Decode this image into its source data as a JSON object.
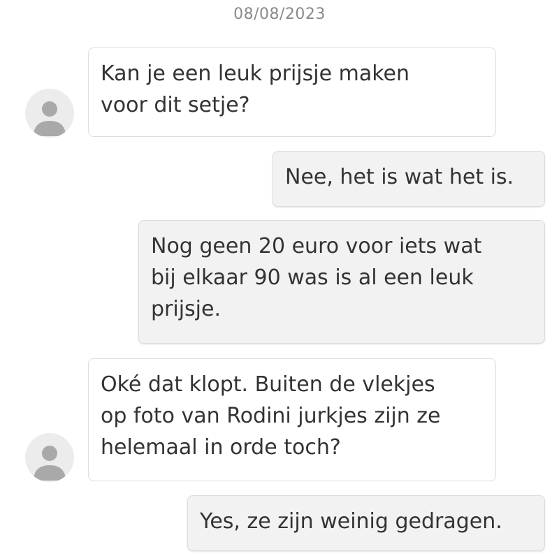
{
  "conversation": {
    "date": "08/08/2023",
    "messages": [
      {
        "direction": "incoming",
        "lines": [
          "Kan je een leuk prijsje maken",
          "voor dit setje?"
        ]
      },
      {
        "direction": "outgoing",
        "lines": [
          "Nee, het is wat het is."
        ]
      },
      {
        "direction": "outgoing",
        "lines": [
          "Nog geen 20 euro voor iets wat",
          "bij elkaar 90 was is al een leuk",
          "prijsje."
        ]
      },
      {
        "direction": "incoming",
        "lines": [
          "Oké dat klopt. Buiten de vlekjes",
          "op foto van Rodini jurkjes zijn ze",
          "helemaal in orde toch?"
        ]
      },
      {
        "direction": "outgoing",
        "lines": [
          "Yes, ze zijn weinig gedragen."
        ]
      }
    ]
  },
  "colors": {
    "avatar_bg": "#ececec",
    "avatar_glyph": "#a9a9a9",
    "outgoing_bg": "#f2f2f2",
    "incoming_bg": "#ffffff",
    "text": "#333333",
    "date_text": "#8a8a8a"
  },
  "icons": {
    "avatar": "user-silhouette-icon"
  }
}
